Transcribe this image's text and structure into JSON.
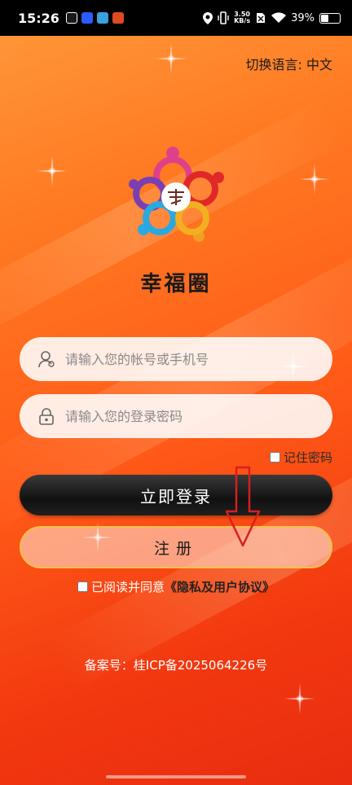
{
  "status_bar": {
    "time": "15:26",
    "speed_value": "3.50",
    "speed_unit": "KB/s",
    "battery": "39%",
    "app_icons": [
      "#1a1a1a",
      "#2a5cff",
      "#3aa0e0",
      "#e04a20"
    ]
  },
  "header": {
    "language_switch": "切换语言: 中文"
  },
  "app": {
    "name": "幸福圈"
  },
  "login_form": {
    "account_placeholder": "请输入您的帐号或手机号",
    "password_placeholder": "请输入您的登录密码",
    "remember_label": "记住密码",
    "login_button": "立即登录",
    "register_button": "注册"
  },
  "agreement": {
    "prefix": "已阅读并同意",
    "link": "《隐私及用户协议》"
  },
  "footer": {
    "icp": "备案号：桂ICP备2025064226号"
  },
  "colors": {
    "background_top": "#ff9a3c",
    "background_bottom": "#e82d10",
    "login_button": "#111111",
    "register_border": "#f2c04c",
    "arrow": "#d42020"
  }
}
